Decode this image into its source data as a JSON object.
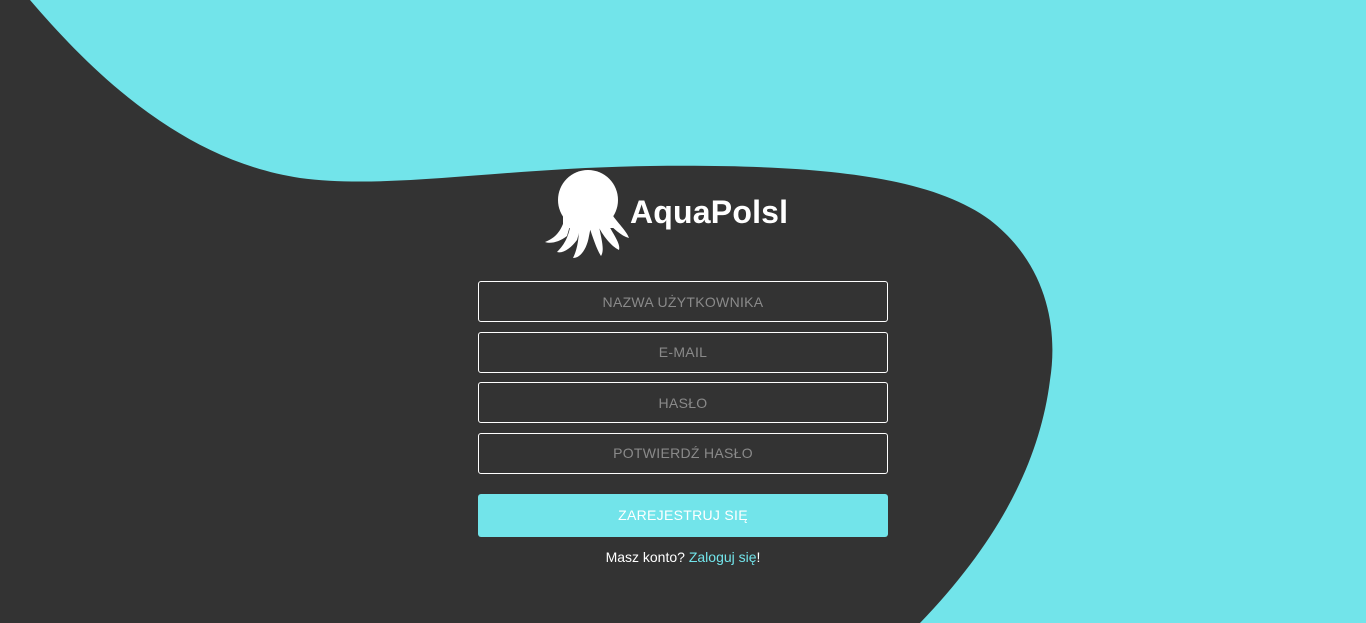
{
  "colors": {
    "accent": "#72e4ea",
    "background": "#333333",
    "text": "#ffffff",
    "placeholder": "#8a8a8a"
  },
  "brand": {
    "name": "AquaPolsl",
    "logo_icon": "octopus-icon"
  },
  "form": {
    "username": {
      "placeholder": "NAZWA UŻYTKOWNIKA",
      "value": ""
    },
    "email": {
      "placeholder": "E-MAIL",
      "value": ""
    },
    "password": {
      "placeholder": "HASŁO",
      "value": ""
    },
    "confirm_password": {
      "placeholder": "POTWIERDŹ HASŁO",
      "value": ""
    },
    "submit_label": "ZAREJESTRUJ SIĘ"
  },
  "login_prompt": {
    "text": "Masz konto? ",
    "link_label": "Zaloguj się",
    "suffix": "!"
  }
}
